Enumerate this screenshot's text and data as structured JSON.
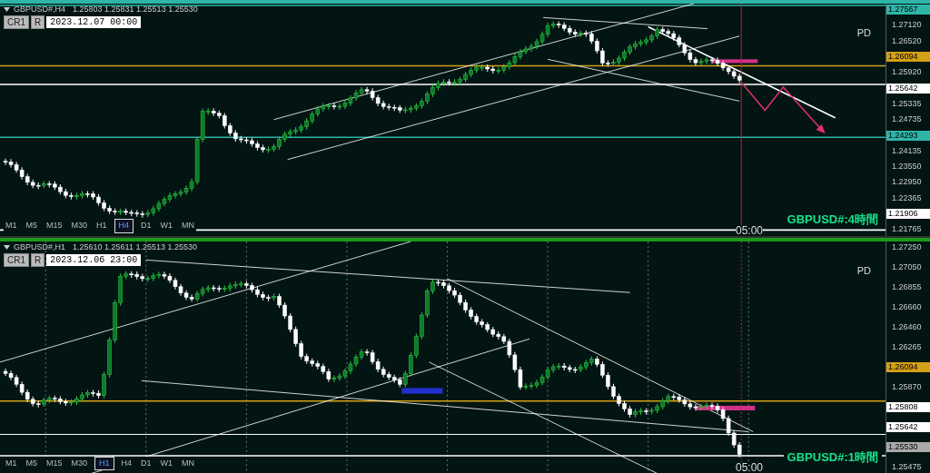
{
  "panels": [
    {
      "symbol": "GBPUSD#,H4",
      "quotes": "1.25803 1.25831 1.25513 1.25530",
      "buttons": [
        "CR1",
        "R"
      ],
      "date": "2023.12.07 00:00",
      "label": "PD",
      "caption": "GBPUSD#:4時間",
      "time_marker": "05:00",
      "timeframes": [
        {
          "label": "M1",
          "selected": false
        },
        {
          "label": "M5",
          "selected": false
        },
        {
          "label": "M15",
          "selected": false
        },
        {
          "label": "M30",
          "selected": false
        },
        {
          "label": "H1",
          "selected": false
        },
        {
          "label": "H4",
          "selected": true
        },
        {
          "label": "D1",
          "selected": false
        },
        {
          "label": "W1",
          "selected": false
        },
        {
          "label": "MN",
          "selected": false
        }
      ],
      "axis": [
        {
          "kind": "tag",
          "text": "1.27567",
          "color": "#2fb5a8"
        },
        {
          "kind": "tick",
          "text": "1.27120"
        },
        {
          "kind": "tick",
          "text": "1.26520"
        },
        {
          "kind": "tag",
          "text": "1.26094",
          "color": "#d4a017"
        },
        {
          "kind": "tick",
          "text": "1.25920"
        },
        {
          "kind": "tag",
          "text": "1.25642",
          "color": "#ffffff"
        },
        {
          "kind": "tick",
          "text": "1.25335"
        },
        {
          "kind": "tick",
          "text": "1.24735"
        },
        {
          "kind": "tag",
          "text": "1.24293",
          "color": "#2fb5a8"
        },
        {
          "kind": "tick",
          "text": "1.24135"
        },
        {
          "kind": "tick",
          "text": "1.23550"
        },
        {
          "kind": "tick",
          "text": "1.22950"
        },
        {
          "kind": "tick",
          "text": "1.22365"
        },
        {
          "kind": "tag",
          "text": "1.21906",
          "color": "#ffffff"
        },
        {
          "kind": "tick",
          "text": "1.21765"
        }
      ]
    },
    {
      "symbol": "GBPUSD#,H1",
      "quotes": "1.25610 1.25611 1.25513 1.25530",
      "buttons": [
        "CR1",
        "R"
      ],
      "date": "2023.12.06 23:00",
      "label": "PD",
      "caption": "GBPUSD#:1時間",
      "time_marker": "05:00",
      "timeframes": [
        {
          "label": "M1",
          "selected": false
        },
        {
          "label": "M5",
          "selected": false
        },
        {
          "label": "M15",
          "selected": false
        },
        {
          "label": "M30",
          "selected": false
        },
        {
          "label": "H1",
          "selected": true
        },
        {
          "label": "H4",
          "selected": false
        },
        {
          "label": "D1",
          "selected": false
        },
        {
          "label": "W1",
          "selected": false
        },
        {
          "label": "MN",
          "selected": false
        }
      ],
      "axis": [
        {
          "kind": "tick",
          "text": "1.27250"
        },
        {
          "kind": "tick",
          "text": "1.27050"
        },
        {
          "kind": "tick",
          "text": "1.26855"
        },
        {
          "kind": "tick",
          "text": "1.26660"
        },
        {
          "kind": "tick",
          "text": "1.26460"
        },
        {
          "kind": "tick",
          "text": "1.26265"
        },
        {
          "kind": "tag",
          "text": "1.26094",
          "color": "#d4a017"
        },
        {
          "kind": "tick",
          "text": "1.25870"
        },
        {
          "kind": "tag",
          "text": "1.25808",
          "color": "#ffffff"
        },
        {
          "kind": "tag",
          "text": "1.25642",
          "color": "#ffffff"
        },
        {
          "kind": "tag",
          "text": "1.25530",
          "color": "#aaaaaa"
        },
        {
          "kind": "tick",
          "text": "1.25475"
        }
      ]
    }
  ]
}
